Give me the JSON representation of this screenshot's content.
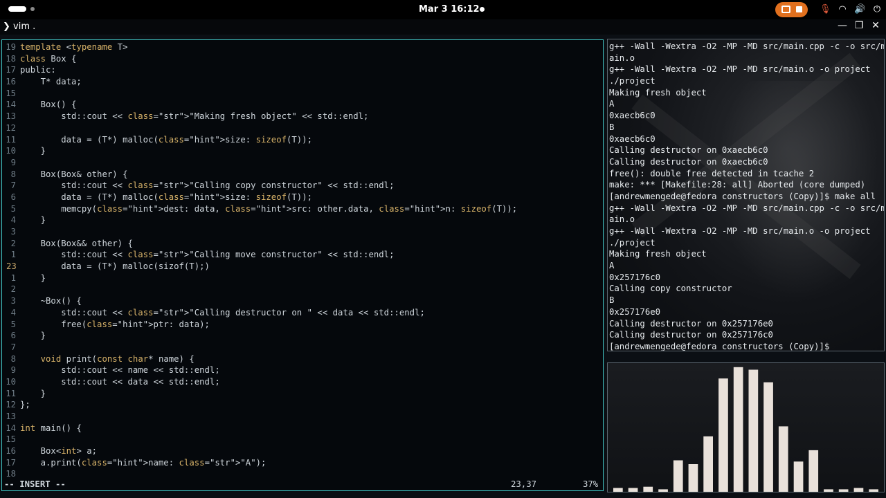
{
  "topbar": {
    "clock": "Mar 3  16:12",
    "tray_icons": [
      "mic-off-icon",
      "wifi-icon",
      "volume-icon",
      "power-icon"
    ]
  },
  "app": {
    "title": "vim .",
    "prompt_glyph": "❯"
  },
  "editor": {
    "lines": [
      {
        "n": "19",
        "t": "template <typename T>"
      },
      {
        "n": "18",
        "t": "class Box {"
      },
      {
        "n": "17",
        "t": "public:"
      },
      {
        "n": "16",
        "t": "    T* data;"
      },
      {
        "n": "15",
        "t": ""
      },
      {
        "n": "14",
        "t": "    Box() {"
      },
      {
        "n": "13",
        "t": "        std::cout << \"Making fresh object\" << std::endl;"
      },
      {
        "n": "12",
        "t": ""
      },
      {
        "n": "11",
        "t": "        data = (T*) malloc(size: sizeof(T));"
      },
      {
        "n": "10",
        "t": "    }"
      },
      {
        "n": "9",
        "t": ""
      },
      {
        "n": "8",
        "t": "    Box(Box& other) {"
      },
      {
        "n": "7",
        "t": "        std::cout << \"Calling copy constructor\" << std::endl;"
      },
      {
        "n": "6",
        "t": "        data = (T*) malloc(size: sizeof(T));"
      },
      {
        "n": "5",
        "t": "        memcpy(dest: data, src: other.data, n: sizeof(T));"
      },
      {
        "n": "4",
        "t": "    }"
      },
      {
        "n": "3",
        "t": ""
      },
      {
        "n": "2",
        "t": "    Box(Box&& other) {"
      },
      {
        "n": "1",
        "t": "        std::cout << \"Calling move constructor\" << std::endl;"
      },
      {
        "n": "23",
        "t": "        data = (T*) malloc(sizof(T);)",
        "current": true
      },
      {
        "n": "1",
        "t": "    }"
      },
      {
        "n": "2",
        "t": ""
      },
      {
        "n": "3",
        "t": "    ~Box() {"
      },
      {
        "n": "4",
        "t": "        std::cout << \"Calling destructor on \" << data << std::endl;"
      },
      {
        "n": "5",
        "t": "        free(ptr: data);"
      },
      {
        "n": "6",
        "t": "    }"
      },
      {
        "n": "7",
        "t": ""
      },
      {
        "n": "8",
        "t": "    void print(const char* name) {"
      },
      {
        "n": "9",
        "t": "        std::cout << name << std::endl;"
      },
      {
        "n": "10",
        "t": "        std::cout << data << std::endl;"
      },
      {
        "n": "11",
        "t": "    }"
      },
      {
        "n": "12",
        "t": "};"
      },
      {
        "n": "13",
        "t": ""
      },
      {
        "n": "14",
        "t": "int main() {"
      },
      {
        "n": "15",
        "t": ""
      },
      {
        "n": "16",
        "t": "    Box<int> a;"
      },
      {
        "n": "17",
        "t": "    a.print(name: \"A\");"
      },
      {
        "n": "18",
        "t": ""
      }
    ],
    "status_mode": "-- INSERT --",
    "status_pos": "23,37",
    "status_pct": "37%"
  },
  "terminal": {
    "lines": [
      "g++ -Wall -Wextra -O2 -MP -MD src/main.cpp -c -o src/m",
      "ain.o",
      "g++ -Wall -Wextra -O2 -MP -MD src/main.o -o project",
      "./project",
      "Making fresh object",
      "A",
      "0xaecb6c0",
      "B",
      "0xaecb6c0",
      "Calling destructor on 0xaecb6c0",
      "Calling destructor on 0xaecb6c0",
      "free(): double free detected in tcache 2",
      "make: *** [Makefile:28: all] Aborted (core dumped)",
      "[andrewmengede@fedora constructors (Copy)]$ make all",
      "g++ -Wall -Wextra -O2 -MP -MD src/main.cpp -c -o src/m",
      "ain.o",
      "g++ -Wall -Wextra -O2 -MP -MD src/main.o -o project",
      "./project",
      "Making fresh object",
      "A",
      "0x257176c0",
      "Calling copy constructor",
      "B",
      "0x257176e0",
      "Calling destructor on 0x257176e0",
      "Calling destructor on 0x257176c0",
      "[andrewmengede@fedora constructors (Copy)]$ "
    ]
  },
  "visualizer": {
    "bar_color": "#e9e1da",
    "levels": [
      0.03,
      0.03,
      0.04,
      0.02,
      0.25,
      0.22,
      0.44,
      0.9,
      0.99,
      0.97,
      0.87,
      0.52,
      0.24,
      0.33,
      0.02,
      0.02,
      0.03,
      0.02
    ]
  }
}
